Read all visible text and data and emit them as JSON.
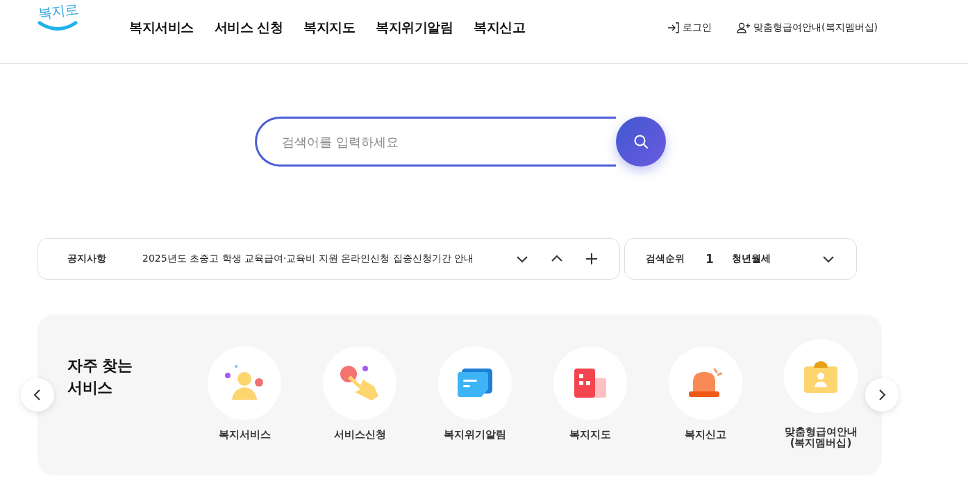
{
  "header": {
    "logo": "복지로",
    "nav": [
      "복지서비스",
      "서비스 신청",
      "복지지도",
      "복지위기알림",
      "복지신고"
    ],
    "utility": [
      {
        "kind": "login",
        "label": "로그인"
      },
      {
        "kind": "member",
        "label": "맞춤형급여안내(복지멤버십)"
      }
    ]
  },
  "search": {
    "placeholder": "검색어를 입력하세요"
  },
  "notice": {
    "label": "공지사항",
    "text": "2025년도 초중고 학생 교육급여·교육비 지원 온라인신청 집중신청기간 안내"
  },
  "ranking": {
    "label": "검색순위",
    "rank": "1",
    "keyword": "청년월세"
  },
  "services": {
    "title": "자주 찾는\n서비스",
    "items": [
      {
        "kind": "person",
        "label": "복지서비스"
      },
      {
        "kind": "hand",
        "label": "서비스신청"
      },
      {
        "kind": "message",
        "label": "복지위기알림"
      },
      {
        "kind": "map",
        "label": "복지지도"
      },
      {
        "kind": "siren",
        "label": "복지신고"
      },
      {
        "kind": "badge",
        "label": "맞춤형급여안내\n(복지멤버십)"
      }
    ]
  }
}
